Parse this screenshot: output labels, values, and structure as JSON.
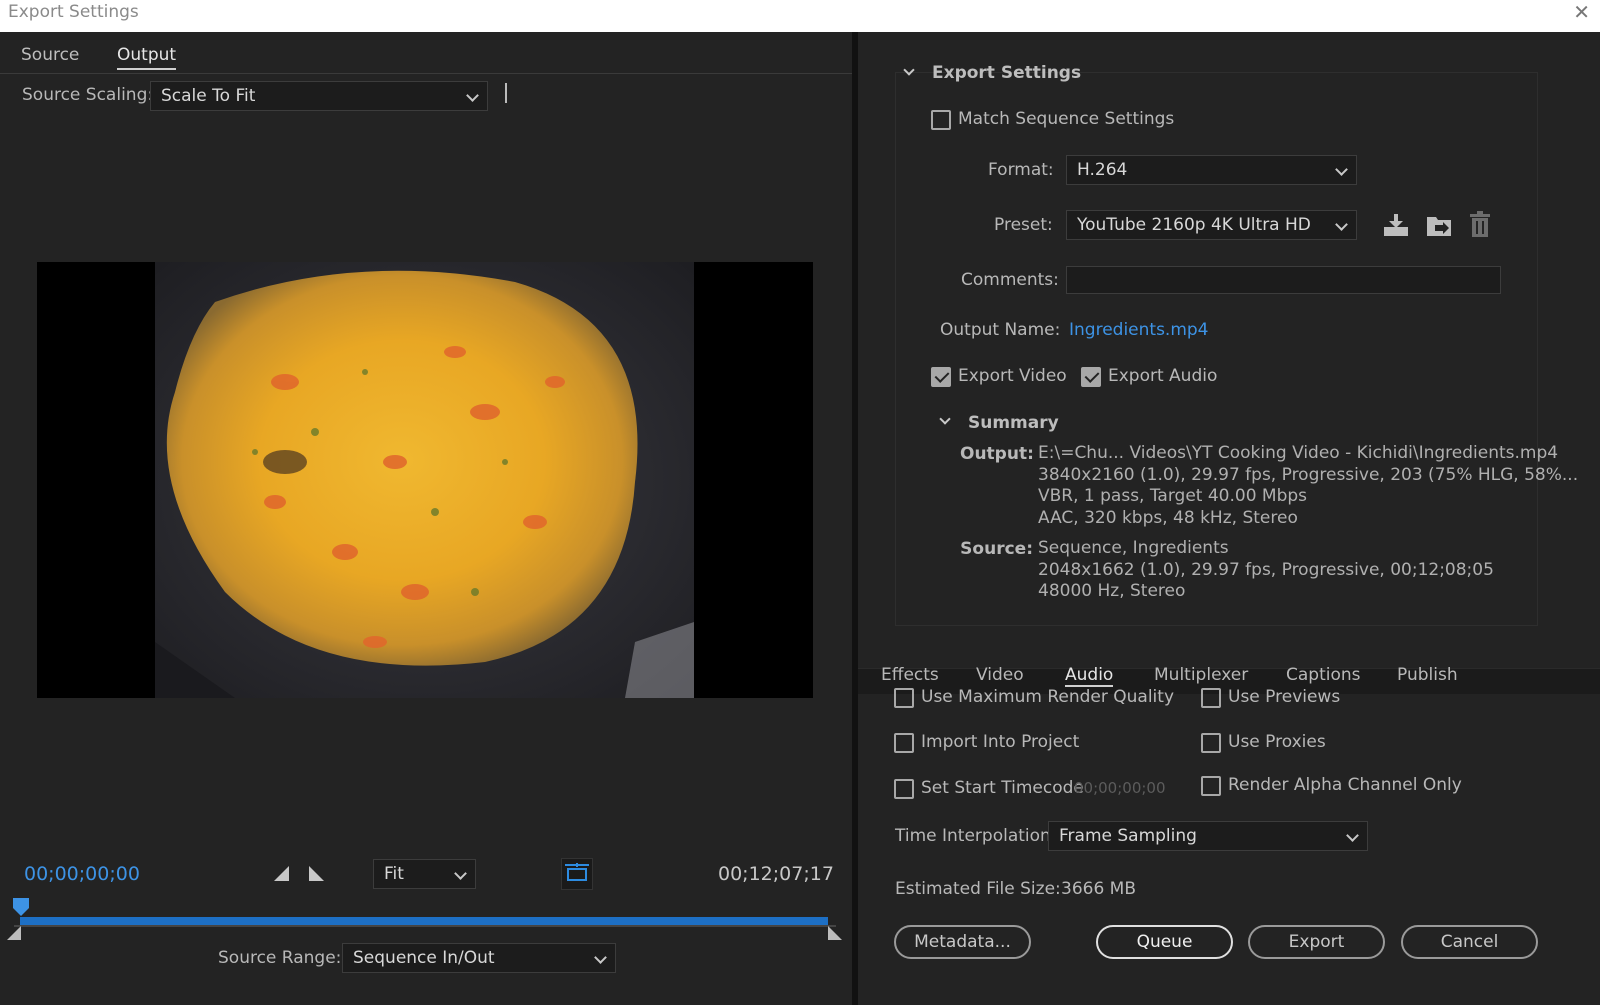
{
  "window": {
    "title": "Export Settings",
    "close": "✕"
  },
  "left": {
    "tabs": [
      {
        "label": "Source"
      },
      {
        "label": "Output"
      }
    ],
    "source_scaling_label": "Source Scaling:",
    "source_scaling_value": "Scale To Fit",
    "timecode_current": "00;00;00;00",
    "timecode_end": "00;12;07;17",
    "zoom_value": "Fit",
    "source_range_label": "Source Range:",
    "source_range_value": "Sequence In/Out"
  },
  "export_settings": {
    "section_title": "Export Settings",
    "match_sequence_label": "Match Sequence Settings",
    "format_label": "Format:",
    "format_value": "H.264",
    "preset_label": "Preset:",
    "preset_value": "YouTube 2160p 4K Ultra HD",
    "comments_label": "Comments:",
    "comments_value": "",
    "output_name_label": "Output Name:",
    "output_name_value": "Ingredients.mp4",
    "export_video_label": "Export Video",
    "export_audio_label": "Export Audio",
    "summary": {
      "title": "Summary",
      "output_label": "Output:",
      "output_lines": [
        "E:\\=Chu... Videos\\YT Cooking Video - Kichidi\\Ingredients.mp4",
        "3840x2160 (1.0), 29.97 fps, Progressive, 203 (75% HLG, 58%...",
        "VBR, 1 pass, Target 40.00 Mbps",
        "AAC, 320 kbps, 48 kHz, Stereo"
      ],
      "source_label": "Source:",
      "source_lines": [
        "Sequence, Ingredients",
        "2048x1662 (1.0), 29.97 fps, Progressive, 00;12;08;05",
        "48000 Hz, Stereo"
      ]
    }
  },
  "bottom_tabs": [
    {
      "label": "Effects"
    },
    {
      "label": "Video"
    },
    {
      "label": "Audio"
    },
    {
      "label": "Multiplexer"
    },
    {
      "label": "Captions"
    },
    {
      "label": "Publish"
    }
  ],
  "options": {
    "max_render_quality": "Use Maximum Render Quality",
    "use_previews": "Use Previews",
    "import_into_project": "Import Into Project",
    "use_proxies": "Use Proxies",
    "set_start_timecode": "Set Start Timecode",
    "start_timecode_value": "00;00;00;00",
    "render_alpha": "Render Alpha Channel Only",
    "time_interp_label": "Time Interpolation:",
    "time_interp_value": "Frame Sampling",
    "est_size_label": "Estimated File Size:",
    "est_size_value": "3666 MB"
  },
  "buttons": {
    "metadata": "Metadata...",
    "queue": "Queue",
    "export": "Export",
    "cancel": "Cancel"
  },
  "colors": {
    "accent": "#3d93e5",
    "timeline": "#1d6fc4",
    "background": "#232323"
  }
}
